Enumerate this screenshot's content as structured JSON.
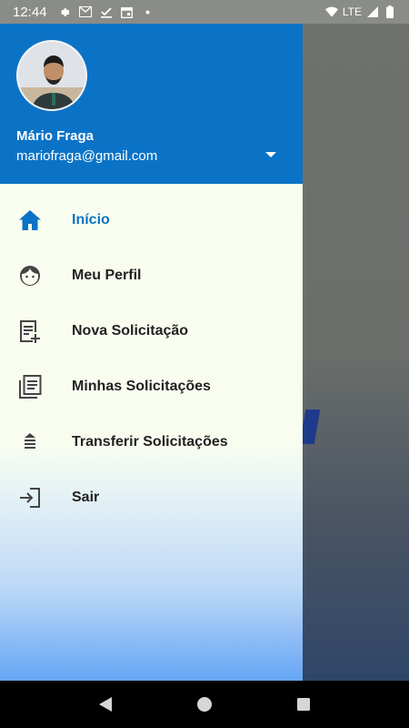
{
  "status_bar": {
    "time": "12:44",
    "network": "LTE",
    "left_icons": [
      "settings-icon",
      "gmail-icon",
      "check-icon",
      "calendar-icon",
      "dot-icon"
    ],
    "right_icons": [
      "wifi-icon",
      "signal-icon",
      "battery-icon"
    ]
  },
  "drawer": {
    "header_color": "#0b73c6",
    "user": {
      "name": "Mário Fraga",
      "email": "mariofraga@gmail.com"
    },
    "menu": [
      {
        "label": "Início",
        "icon": "home-icon",
        "active": true
      },
      {
        "label": "Meu Perfil",
        "icon": "profile-face-icon",
        "active": false
      },
      {
        "label": "Nova Solicitação",
        "icon": "new-request-icon",
        "active": false
      },
      {
        "label": "Minhas Solicitações",
        "icon": "my-requests-icon",
        "active": false
      },
      {
        "label": "Transferir Solicitações",
        "icon": "transfer-icon",
        "active": false
      },
      {
        "label": "Sair",
        "icon": "logout-icon",
        "active": false
      }
    ]
  },
  "nav_bar": {
    "buttons": [
      "back-icon",
      "home-circle-icon",
      "recents-icon"
    ]
  }
}
